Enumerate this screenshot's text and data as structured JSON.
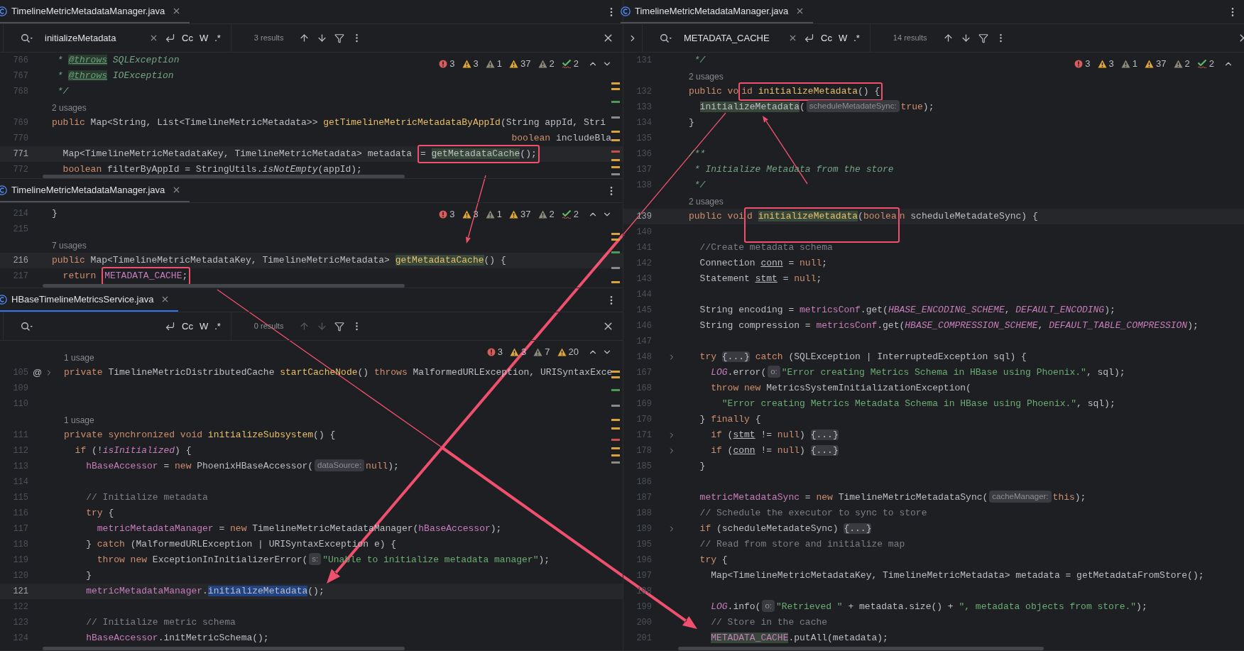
{
  "panes": [
    {
      "editors": [
        {
          "tab": {
            "title": "TimelineMetricMetadataManager.java",
            "focused": false
          },
          "find": {
            "query": "initializeMetadata",
            "options": [
              "Cc",
              "W",
              ".*"
            ],
            "results": "3 results",
            "navigation_enabled": true,
            "expand_toggle": false
          },
          "inspections": [
            {
              "kind": "error",
              "count": "3"
            },
            {
              "kind": "warning",
              "count": "3"
            },
            {
              "kind": "weak",
              "count": "1"
            },
            {
              "kind": "warning",
              "count": "37"
            },
            {
              "kind": "weak",
              "count": "2"
            },
            {
              "kind": "typo",
              "count": "2"
            }
          ],
          "nav": [
            {
              "kind": "up"
            },
            {
              "kind": "down"
            }
          ],
          "lines": [
            {
              "kind": "code",
              "num": "766",
              "current": false,
              "tokens": [
                {
                  "kind": "doc",
                  "text": " * "
                },
                {
                  "kind": "tag",
                  "text": "@throws"
                },
                {
                  "kind": "doc",
                  "text": " SQLException"
                }
              ]
            },
            {
              "kind": "code",
              "num": "767",
              "current": false,
              "tokens": [
                {
                  "kind": "doc",
                  "text": " * "
                },
                {
                  "kind": "tag",
                  "text": "@throws"
                },
                {
                  "kind": "doc",
                  "text": " IOException"
                }
              ]
            },
            {
              "kind": "code",
              "num": "768",
              "current": false,
              "tokens": [
                {
                  "kind": "doc",
                  "text": " */"
                }
              ]
            },
            {
              "kind": "usages",
              "text": "2 usages"
            },
            {
              "kind": "code",
              "num": "769",
              "current": false,
              "tokens": [
                {
                  "kind": "kw",
                  "text": "public "
                },
                {
                  "kind": "p",
                  "text": "Map<String, List<TimelineMetricMetadata>> "
                },
                {
                  "kind": "fn",
                  "text": "getTimelineMetricMetadataByAppId"
                },
                {
                  "kind": "p",
                  "text": "(String appId, Stri"
                }
              ]
            },
            {
              "kind": "code",
              "num": "770",
              "current": false,
              "tokens": [
                {
                  "kind": "kw",
                  "text": "                                                                                   boolean"
                },
                {
                  "kind": "p",
                  "text": " includeBla"
                }
              ]
            },
            {
              "kind": "code",
              "num": "771",
              "current": true,
              "tokens": [
                {
                  "kind": "p",
                  "text": "  Map<TimelineMetricMetadataKey, TimelineMetricMetadata> metadata "
                },
                {
                  "kind": "box",
                  "tall": false,
                  "tokens": [
                    {
                      "kind": "p",
                      "text": "= "
                    },
                    {
                      "kind": "call",
                      "text": "getMetadataCache",
                      "highlighted": true
                    },
                    {
                      "kind": "p",
                      "text": "();"
                    }
                  ]
                }
              ]
            },
            {
              "kind": "code",
              "num": "772",
              "current": false,
              "tokens": [
                {
                  "kind": "kw",
                  "text": "  boolean"
                },
                {
                  "kind": "p",
                  "text": " filterByAppId = StringUtils."
                },
                {
                  "kind": "ital",
                  "text": "isNotEmpty"
                },
                {
                  "kind": "p",
                  "text": "(appId);"
                }
              ]
            }
          ]
        },
        {
          "tab": {
            "title": "TimelineMetricMetadataManager.java",
            "focused": false
          },
          "inspections": [
            {
              "kind": "error",
              "count": "3"
            },
            {
              "kind": "warning",
              "count": "3"
            },
            {
              "kind": "weak",
              "count": "1"
            },
            {
              "kind": "warning",
              "count": "37"
            },
            {
              "kind": "weak",
              "count": "2"
            },
            {
              "kind": "typo",
              "count": "2"
            }
          ],
          "nav": [
            {
              "kind": "up"
            },
            {
              "kind": "down"
            }
          ],
          "lines": [
            {
              "kind": "code",
              "num": "214",
              "current": false,
              "tokens": [
                {
                  "kind": "p",
                  "text": "}"
                }
              ]
            },
            {
              "kind": "code",
              "num": "215",
              "current": false
            },
            {
              "kind": "usages",
              "text": "7 usages"
            },
            {
              "kind": "code",
              "num": "216",
              "current": true,
              "tokens": [
                {
                  "kind": "kw",
                  "text": "public "
                },
                {
                  "kind": "p",
                  "text": "Map<TimelineMetricMetadataKey, TimelineMetricMetadata> "
                },
                {
                  "kind": "fn",
                  "text": "getMetadataCache",
                  "highlighted": true
                },
                {
                  "kind": "p",
                  "text": "() {"
                }
              ]
            },
            {
              "kind": "code",
              "num": "217",
              "current": false,
              "tokens": [
                {
                  "kind": "kw",
                  "text": "  return "
                },
                {
                  "kind": "box",
                  "tall": false,
                  "tokens": [
                    {
                      "kind": "field",
                      "text": "METADATA_CACHE"
                    },
                    {
                      "kind": "p",
                      "text": ";"
                    }
                  ]
                }
              ]
            }
          ]
        },
        {
          "tab": {
            "title": "HBaseTimelineMetricsService.java",
            "focused": true
          },
          "find": {
            "options": [
              "Cc",
              "W",
              ".*"
            ],
            "results": "0 results",
            "navigation_enabled": false,
            "expand_toggle": false
          },
          "inspections": [
            {
              "kind": "error",
              "count": "3"
            },
            {
              "kind": "warning",
              "count": "3"
            },
            {
              "kind": "weak",
              "count": "7"
            },
            {
              "kind": "warning",
              "count": "20"
            }
          ],
          "nav": [
            {
              "kind": "up"
            },
            {
              "kind": "down"
            }
          ],
          "lines": [
            {
              "kind": "usages",
              "text": "1 usage"
            },
            {
              "kind": "code",
              "num": "105",
              "current": false,
              "gutter_mark": "@",
              "fold": true,
              "tokens": [
                {
                  "kind": "kw",
                  "text": "private "
                },
                {
                  "kind": "p",
                  "text": "TimelineMetricDistributedCache "
                },
                {
                  "kind": "fn",
                  "text": "startCacheNode"
                },
                {
                  "kind": "p",
                  "text": "() "
                },
                {
                  "kind": "kw",
                  "text": "throws "
                },
                {
                  "kind": "p",
                  "text": "MalformedURLException, URISyntaxExce"
                }
              ]
            },
            {
              "kind": "code",
              "num": "109",
              "current": false
            },
            {
              "kind": "code",
              "num": "110",
              "current": false
            },
            {
              "kind": "usages",
              "text": "1 usage"
            },
            {
              "kind": "code",
              "num": "111",
              "current": false,
              "tokens": [
                {
                  "kind": "kw",
                  "text": "private synchronized void "
                },
                {
                  "kind": "fn",
                  "text": "initializeSubsystem"
                },
                {
                  "kind": "p",
                  "text": "() {"
                }
              ]
            },
            {
              "kind": "code",
              "num": "112",
              "current": false,
              "tokens": [
                {
                  "kind": "kw",
                  "text": "  if "
                },
                {
                  "kind": "p",
                  "text": "(!"
                },
                {
                  "kind": "static",
                  "text": "isInitialized"
                },
                {
                  "kind": "p",
                  "text": ") {"
                }
              ]
            },
            {
              "kind": "code",
              "num": "113",
              "current": false,
              "tokens": [
                {
                  "kind": "field",
                  "text": "    hBaseAccessor"
                },
                {
                  "kind": "p",
                  "text": " = "
                },
                {
                  "kind": "kw",
                  "text": "new "
                },
                {
                  "kind": "p",
                  "text": "PhoenixHBaseAccessor("
                },
                {
                  "kind": "hint",
                  "text": "dataSource:"
                },
                {
                  "kind": "kw",
                  "text": "null"
                },
                {
                  "kind": "p",
                  "text": ");"
                }
              ]
            },
            {
              "kind": "code",
              "num": "114",
              "current": false
            },
            {
              "kind": "code",
              "num": "115",
              "current": false,
              "tokens": [
                {
                  "kind": "cmt",
                  "text": "    // Initialize metadata"
                }
              ]
            },
            {
              "kind": "code",
              "num": "116",
              "current": false,
              "tokens": [
                {
                  "kind": "kw",
                  "text": "    try "
                },
                {
                  "kind": "p",
                  "text": "{"
                }
              ]
            },
            {
              "kind": "code",
              "num": "117",
              "current": false,
              "tokens": [
                {
                  "kind": "field",
                  "text": "      metricMetadataManager"
                },
                {
                  "kind": "p",
                  "text": " = "
                },
                {
                  "kind": "kw",
                  "text": "new "
                },
                {
                  "kind": "p",
                  "text": "TimelineMetricMetadataManager("
                },
                {
                  "kind": "field",
                  "text": "hBaseAccessor"
                },
                {
                  "kind": "p",
                  "text": ");"
                }
              ]
            },
            {
              "kind": "code",
              "num": "118",
              "current": false,
              "tokens": [
                {
                  "kind": "p",
                  "text": "    } "
                },
                {
                  "kind": "kw",
                  "text": "catch "
                },
                {
                  "kind": "p",
                  "text": "(MalformedURLException | URISyntaxException e) {"
                }
              ]
            },
            {
              "kind": "code",
              "num": "119",
              "current": false,
              "tokens": [
                {
                  "kind": "kw",
                  "text": "      throw new "
                },
                {
                  "kind": "p",
                  "text": "ExceptionInInitializerError("
                },
                {
                  "kind": "hint",
                  "text": "s:"
                },
                {
                  "kind": "str",
                  "text": "\"Unable to initialize metadata manager\""
                },
                {
                  "kind": "p",
                  "text": ");"
                }
              ]
            },
            {
              "kind": "code",
              "num": "120",
              "current": false,
              "tokens": [
                {
                  "kind": "p",
                  "text": "    }"
                }
              ]
            },
            {
              "kind": "code",
              "num": "121",
              "current": true,
              "tokens": [
                {
                  "kind": "field",
                  "text": "    metricMetadataManager"
                },
                {
                  "kind": "p",
                  "text": "."
                },
                {
                  "kind": "call",
                  "text": "initializeMetadata",
                  "selected": true
                },
                {
                  "kind": "p",
                  "text": "();"
                }
              ]
            },
            {
              "kind": "code",
              "num": "122",
              "current": false
            },
            {
              "kind": "code",
              "num": "123",
              "current": false,
              "tokens": [
                {
                  "kind": "cmt",
                  "text": "    // Initialize metric schema"
                }
              ]
            },
            {
              "kind": "code",
              "num": "124",
              "current": false,
              "tokens": [
                {
                  "kind": "field",
                  "text": "    hBaseAccessor"
                },
                {
                  "kind": "p",
                  "text": ".initMetricSchema();"
                }
              ]
            }
          ]
        }
      ]
    },
    {
      "editors": [
        {
          "tab": {
            "title": "TimelineMetricMetadataManager.java",
            "focused": false
          },
          "find": {
            "query": "METADATA_CACHE",
            "options": [
              "Cc",
              "W",
              ".*"
            ],
            "results": "14 results",
            "navigation_enabled": true,
            "expand_toggle": true
          },
          "inspections": [
            {
              "kind": "error",
              "count": "3"
            },
            {
              "kind": "warning",
              "count": "3"
            },
            {
              "kind": "weak",
              "count": "1"
            },
            {
              "kind": "warning",
              "count": "37"
            },
            {
              "kind": "weak",
              "count": "2"
            },
            {
              "kind": "typo",
              "count": "2"
            }
          ],
          "nav": [
            {
              "kind": "up"
            }
          ],
          "lines": [
            {
              "kind": "code",
              "num": "131",
              "current": false,
              "tokens": [
                {
                  "kind": "doc",
                  "text": " */"
                }
              ]
            },
            {
              "kind": "usages",
              "text": "2 usages"
            },
            {
              "kind": "code",
              "num": "132",
              "current": false,
              "tokens": [
                {
                  "kind": "kw",
                  "text": "public vo"
                },
                {
                  "kind": "box",
                  "tall": false,
                  "tokens": [
                    {
                      "kind": "kw",
                      "text": "id "
                    },
                    {
                      "kind": "fn",
                      "text": "initializeMetadata"
                    },
                    {
                      "kind": "p",
                      "text": "() {"
                    }
                  ]
                }
              ]
            },
            {
              "kind": "code",
              "num": "133",
              "current": false,
              "tokens": [
                {
                  "kind": "call",
                  "text": "  initializeMetadata",
                  "highlighted": true
                },
                {
                  "kind": "p",
                  "text": "("
                },
                {
                  "kind": "hint",
                  "text": "scheduleMetadateSync:"
                },
                {
                  "kind": "kw",
                  "text": "true"
                },
                {
                  "kind": "p",
                  "text": ");"
                }
              ]
            },
            {
              "kind": "code",
              "num": "134",
              "current": false,
              "tokens": [
                {
                  "kind": "p",
                  "text": "}"
                }
              ]
            },
            {
              "kind": "code",
              "num": "135",
              "current": false
            },
            {
              "kind": "code",
              "num": "136",
              "current": false,
              "tokens": [
                {
                  "kind": "doc",
                  "text": "/**"
                }
              ]
            },
            {
              "kind": "code",
              "num": "137",
              "current": false,
              "tokens": [
                {
                  "kind": "doc",
                  "text": " * Initialize Metadata from the store"
                }
              ]
            },
            {
              "kind": "code",
              "num": "138",
              "current": false,
              "tokens": [
                {
                  "kind": "doc",
                  "text": " */"
                }
              ]
            },
            {
              "kind": "usages",
              "text": "2 usages"
            },
            {
              "kind": "code",
              "num": "139",
              "current": true,
              "tokens": [
                {
                  "kind": "kw",
                  "text": "public voi"
                },
                {
                  "kind": "box",
                  "tall": true,
                  "tokens": [
                    {
                      "kind": "kw",
                      "text": "d "
                    },
                    {
                      "kind": "fn",
                      "text": "initializeMetadata",
                      "highlighted": true
                    },
                    {
                      "kind": "p",
                      "text": "("
                    },
                    {
                      "kind": "kw",
                      "text": "boolea"
                    }
                  ]
                },
                {
                  "kind": "kw",
                  "text": "n"
                },
                {
                  "kind": "p",
                  "text": " scheduleMetadateSync) {"
                }
              ]
            },
            {
              "kind": "code",
              "num": "140",
              "current": false
            },
            {
              "kind": "code",
              "num": "141",
              "current": false,
              "tokens": [
                {
                  "kind": "cmt",
                  "text": "  //Create metadata schema"
                }
              ]
            },
            {
              "kind": "code",
              "num": "142",
              "current": false,
              "tokens": [
                {
                  "kind": "p",
                  "text": "  Connection "
                },
                {
                  "kind": "ul",
                  "text": "conn"
                },
                {
                  "kind": "p",
                  "text": " = "
                },
                {
                  "kind": "kw",
                  "text": "null"
                },
                {
                  "kind": "p",
                  "text": ";"
                }
              ]
            },
            {
              "kind": "code",
              "num": "143",
              "current": false,
              "tokens": [
                {
                  "kind": "p",
                  "text": "  Statement "
                },
                {
                  "kind": "ul",
                  "text": "stmt"
                },
                {
                  "kind": "p",
                  "text": " = "
                },
                {
                  "kind": "kw",
                  "text": "null"
                },
                {
                  "kind": "p",
                  "text": ";"
                }
              ]
            },
            {
              "kind": "code",
              "num": "144",
              "current": false
            },
            {
              "kind": "code",
              "num": "145",
              "current": false,
              "tokens": [
                {
                  "kind": "p",
                  "text": "  String encoding = "
                },
                {
                  "kind": "field",
                  "text": "metricsConf"
                },
                {
                  "kind": "p",
                  "text": ".get("
                },
                {
                  "kind": "static",
                  "text": "HBASE_ENCODING_SCHEME"
                },
                {
                  "kind": "p",
                  "text": ", "
                },
                {
                  "kind": "static",
                  "text": "DEFAULT_ENCODING"
                },
                {
                  "kind": "p",
                  "text": ");"
                }
              ]
            },
            {
              "kind": "code",
              "num": "146",
              "current": false,
              "tokens": [
                {
                  "kind": "p",
                  "text": "  String compression = "
                },
                {
                  "kind": "field",
                  "text": "metricsConf"
                },
                {
                  "kind": "p",
                  "text": ".get("
                },
                {
                  "kind": "static",
                  "text": "HBASE_COMPRESSION_SCHEME"
                },
                {
                  "kind": "p",
                  "text": ", "
                },
                {
                  "kind": "static",
                  "text": "DEFAULT_TABLE_COMPRESSION"
                },
                {
                  "kind": "p",
                  "text": ");"
                }
              ]
            },
            {
              "kind": "code",
              "num": "147",
              "current": false
            },
            {
              "kind": "code",
              "num": "148",
              "current": false,
              "fold": true,
              "tokens": [
                {
                  "kind": "kw",
                  "text": "  try "
                },
                {
                  "kind": "fold",
                  "text": "{...}"
                },
                {
                  "kind": "kw",
                  "text": " catch "
                },
                {
                  "kind": "p",
                  "text": "(SQLException | InterruptedException sql) {"
                }
              ]
            },
            {
              "kind": "code",
              "num": "167",
              "current": false,
              "tokens": [
                {
                  "kind": "static",
                  "text": "    LOG"
                },
                {
                  "kind": "p",
                  "text": ".error("
                },
                {
                  "kind": "hint",
                  "text": "o:"
                },
                {
                  "kind": "str",
                  "text": "\"Error creating Metrics Schema in HBase using Phoenix.\""
                },
                {
                  "kind": "p",
                  "text": ", sql);"
                }
              ]
            },
            {
              "kind": "code",
              "num": "168",
              "current": false,
              "tokens": [
                {
                  "kind": "kw",
                  "text": "    throw new "
                },
                {
                  "kind": "p",
                  "text": "MetricsSystemInitializationException("
                }
              ]
            },
            {
              "kind": "code",
              "num": "169",
              "current": false,
              "tokens": [
                {
                  "kind": "str",
                  "text": "      \"Error creating Metrics Metadata Schema in HBase using Phoenix.\""
                },
                {
                  "kind": "p",
                  "text": ", sql);"
                }
              ]
            },
            {
              "kind": "code",
              "num": "170",
              "current": false,
              "tokens": [
                {
                  "kind": "p",
                  "text": "  } "
                },
                {
                  "kind": "kw",
                  "text": "finally "
                },
                {
                  "kind": "p",
                  "text": "{"
                }
              ]
            },
            {
              "kind": "code",
              "num": "171",
              "current": false,
              "fold": true,
              "tokens": [
                {
                  "kind": "kw",
                  "text": "    if "
                },
                {
                  "kind": "p",
                  "text": "("
                },
                {
                  "kind": "ul",
                  "text": "stmt"
                },
                {
                  "kind": "p",
                  "text": " != "
                },
                {
                  "kind": "kw",
                  "text": "null"
                },
                {
                  "kind": "p",
                  "text": ") "
                },
                {
                  "kind": "fold",
                  "text": "{...}"
                }
              ]
            },
            {
              "kind": "code",
              "num": "178",
              "current": false,
              "fold": true,
              "tokens": [
                {
                  "kind": "kw",
                  "text": "    if "
                },
                {
                  "kind": "p",
                  "text": "("
                },
                {
                  "kind": "ul",
                  "text": "conn"
                },
                {
                  "kind": "p",
                  "text": " != "
                },
                {
                  "kind": "kw",
                  "text": "null"
                },
                {
                  "kind": "p",
                  "text": ") "
                },
                {
                  "kind": "fold",
                  "text": "{...}"
                }
              ]
            },
            {
              "kind": "code",
              "num": "185",
              "current": false,
              "tokens": [
                {
                  "kind": "p",
                  "text": "  }"
                }
              ]
            },
            {
              "kind": "code",
              "num": "186",
              "current": false
            },
            {
              "kind": "code",
              "num": "187",
              "current": false,
              "tokens": [
                {
                  "kind": "field",
                  "text": "  metricMetadataSync"
                },
                {
                  "kind": "p",
                  "text": " = "
                },
                {
                  "kind": "kw",
                  "text": "new "
                },
                {
                  "kind": "p",
                  "text": "TimelineMetricMetadataSync("
                },
                {
                  "kind": "hint",
                  "text": "cacheManager:"
                },
                {
                  "kind": "kw",
                  "text": "this"
                },
                {
                  "kind": "p",
                  "text": ");"
                }
              ]
            },
            {
              "kind": "code",
              "num": "188",
              "current": false,
              "tokens": [
                {
                  "kind": "cmt",
                  "text": "  // Schedule the executor to sync to store"
                }
              ]
            },
            {
              "kind": "code",
              "num": "189",
              "current": false,
              "fold": true,
              "tokens": [
                {
                  "kind": "kw",
                  "text": "  if "
                },
                {
                  "kind": "p",
                  "text": "(scheduleMetadateSync) "
                },
                {
                  "kind": "fold",
                  "text": "{...}"
                }
              ]
            },
            {
              "kind": "code",
              "num": "195",
              "current": false,
              "tokens": [
                {
                  "kind": "cmt",
                  "text": "  // Read from store and initialize map"
                }
              ]
            },
            {
              "kind": "code",
              "num": "196",
              "current": false,
              "tokens": [
                {
                  "kind": "kw",
                  "text": "  try "
                },
                {
                  "kind": "p",
                  "text": "{"
                }
              ]
            },
            {
              "kind": "code",
              "num": "197",
              "current": false,
              "tokens": [
                {
                  "kind": "p",
                  "text": "    Map<TimelineMetricMetadataKey, TimelineMetricMetadata> metadata = getMetadataFromStore();"
                }
              ]
            },
            {
              "kind": "code",
              "num": "198",
              "current": false
            },
            {
              "kind": "code",
              "num": "199",
              "current": false,
              "tokens": [
                {
                  "kind": "static",
                  "text": "    LOG"
                },
                {
                  "kind": "p",
                  "text": ".info("
                },
                {
                  "kind": "hint",
                  "text": "o:"
                },
                {
                  "kind": "str",
                  "text": "\"Retrieved \""
                },
                {
                  "kind": "p",
                  "text": " + metadata.size() + "
                },
                {
                  "kind": "str",
                  "text": "\", metadata objects from store.\""
                },
                {
                  "kind": "p",
                  "text": ");"
                }
              ]
            },
            {
              "kind": "code",
              "num": "200",
              "current": false,
              "tokens": [
                {
                  "kind": "cmt",
                  "text": "    // Store in the cache"
                }
              ]
            },
            {
              "kind": "code",
              "num": "201",
              "current": false,
              "tokens": [
                {
                  "kind": "field",
                  "text": "    METADATA_CACHE",
                  "highlighted": true
                },
                {
                  "kind": "p",
                  "text": ".putAll(metadata);"
                }
              ]
            }
          ]
        }
      ]
    }
  ]
}
